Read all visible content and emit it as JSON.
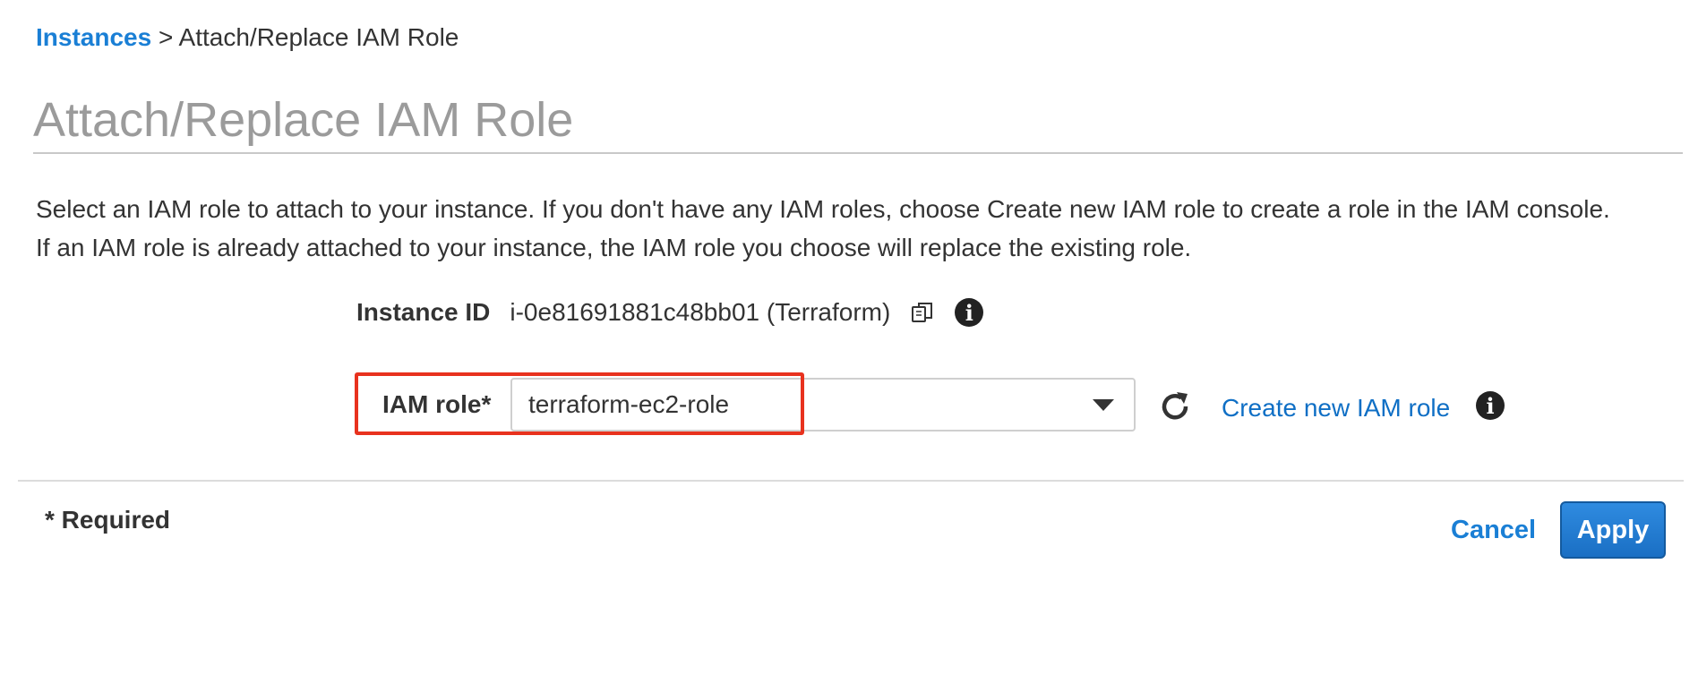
{
  "breadcrumb": {
    "link": "Instances",
    "separator": ">",
    "current": "Attach/Replace IAM Role"
  },
  "page_title": "Attach/Replace IAM Role",
  "description": {
    "line1": "Select an IAM role to attach to your instance. If you don't have any IAM roles, choose Create new IAM role to create a role in the IAM console.",
    "line2": "If an IAM role is already attached to your instance, the IAM role you choose will replace the existing role."
  },
  "instance": {
    "label": "Instance ID",
    "value": "i-0e81691881c48bb01 (Terraform)",
    "copy_icon": "copy-icon",
    "info_icon": "info-icon"
  },
  "iam_role": {
    "label": "IAM role*",
    "selected": "terraform-ec2-role",
    "dropdown_icon": "chevron-down-icon",
    "refresh_icon": "refresh-icon",
    "create_link": "Create new IAM role",
    "info_icon": "info-icon",
    "highlight_color": "#e8321e"
  },
  "footer": {
    "required_note": "* Required",
    "cancel_label": "Cancel",
    "apply_label": "Apply"
  },
  "colors": {
    "link": "#1a7fd5",
    "primary_button": "#1a6fc4",
    "title": "#9b9b9b"
  }
}
